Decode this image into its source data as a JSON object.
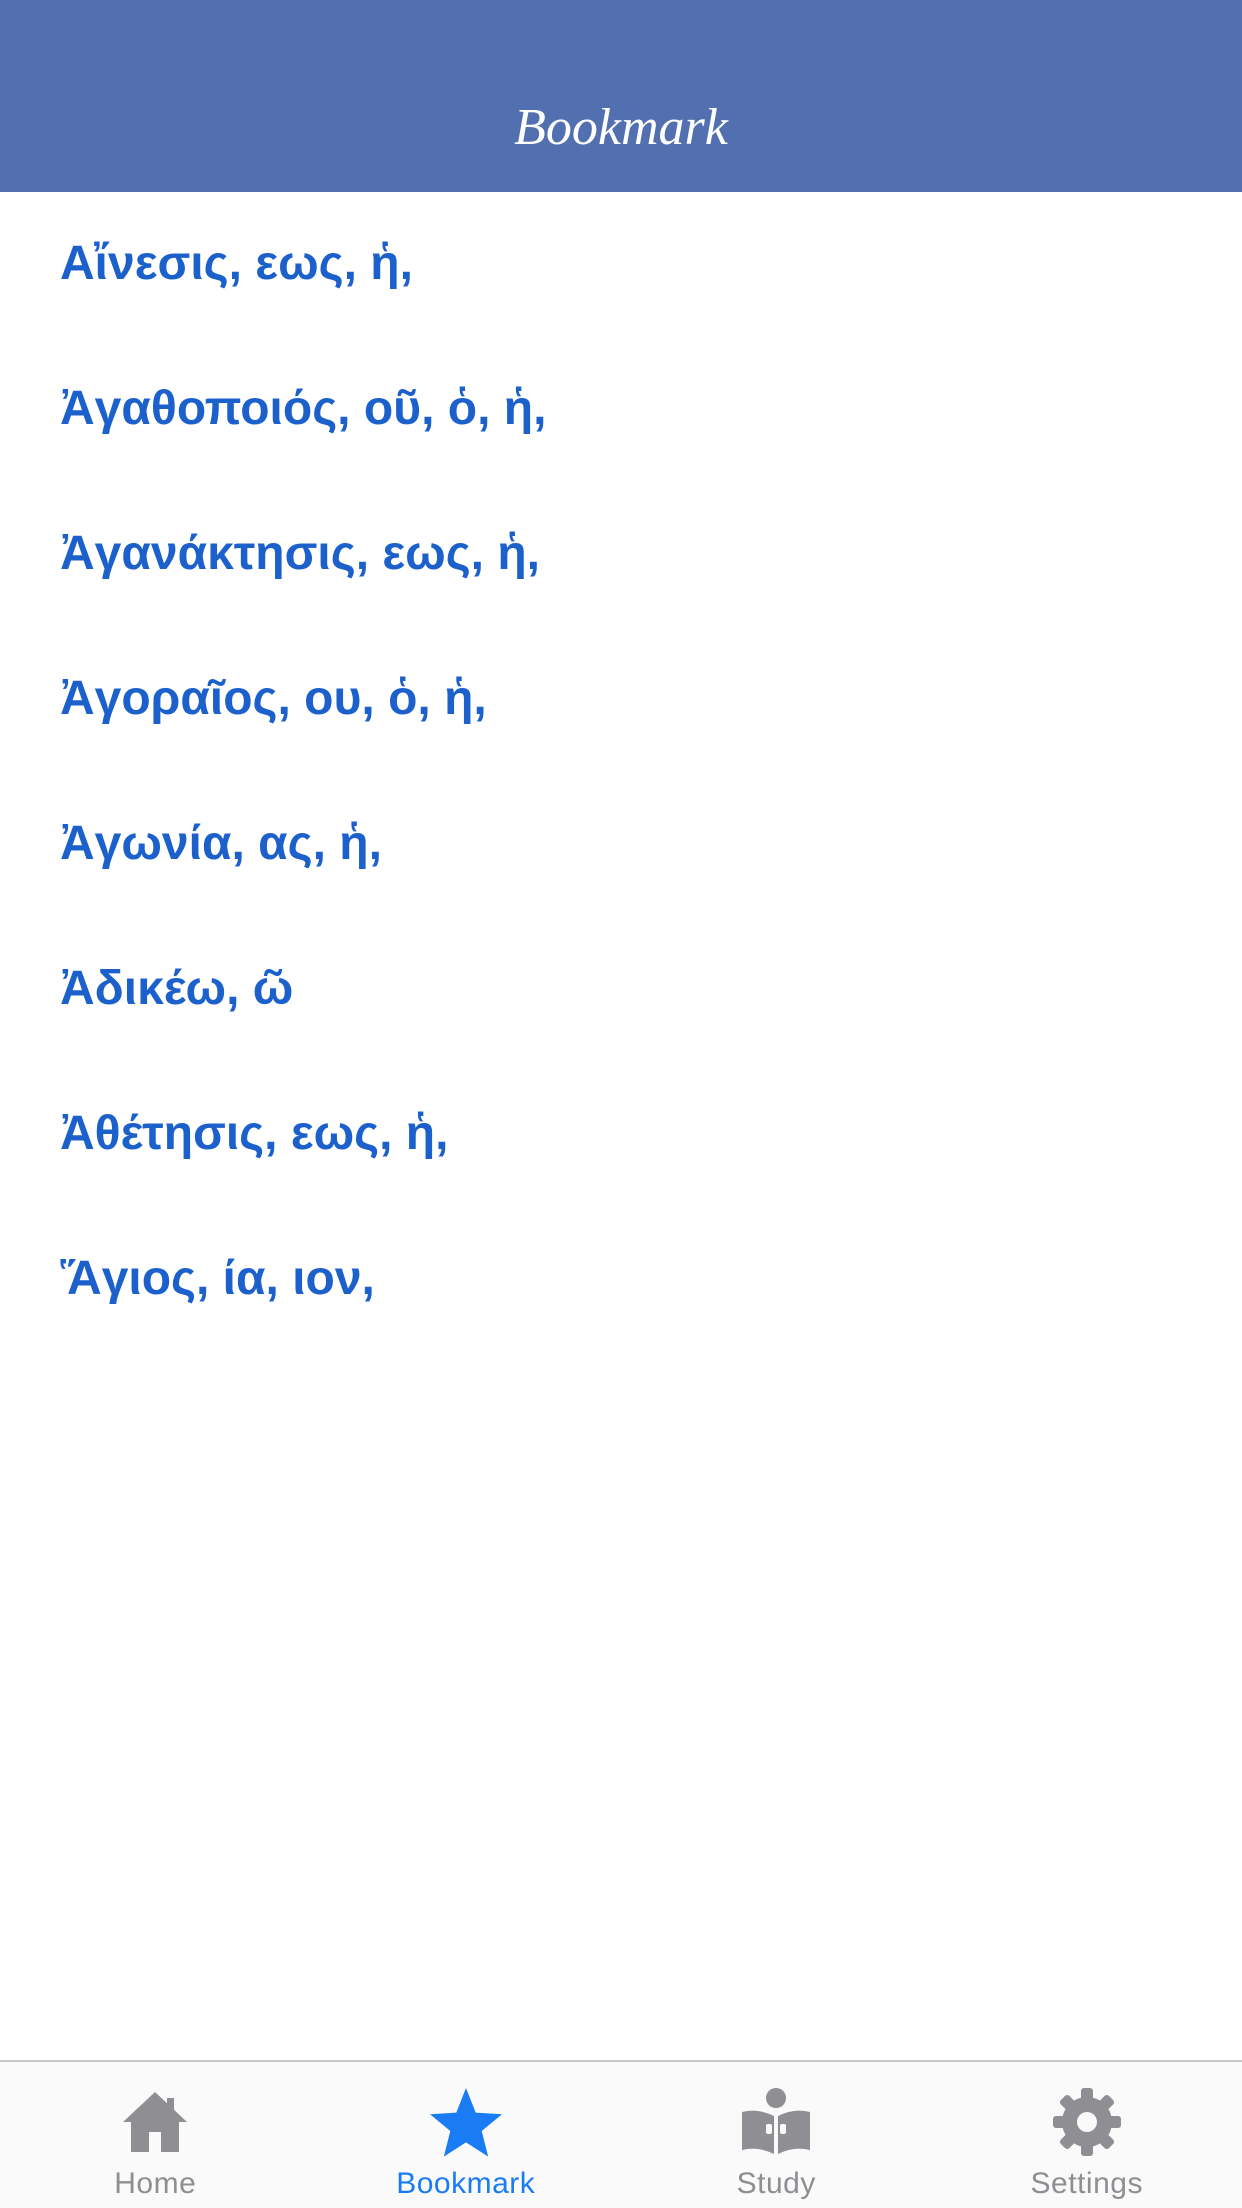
{
  "header": {
    "title": "Bookmark"
  },
  "bookmarks": [
    "Αἴνεσις, εως, ἡ,",
    "Ἀγαθοποιός, οῦ, ὁ, ἡ,",
    "Ἀγανάκτησις, εως, ἡ,",
    "Ἀγοραῖος, ου, ὁ, ἡ,",
    "Ἀγωνία, ας, ἡ,",
    "Ἀδικέω, ῶ",
    "Ἀθέτησις, εως, ἡ,",
    "Ἅγιος, ία, ιον,"
  ],
  "tabs": [
    {
      "label": "Home",
      "icon": "home-icon",
      "active": false
    },
    {
      "label": "Bookmark",
      "icon": "star-icon",
      "active": true
    },
    {
      "label": "Study",
      "icon": "book-icon",
      "active": false
    },
    {
      "label": "Settings",
      "icon": "gear-icon",
      "active": false
    }
  ],
  "colors": {
    "header_bg": "#5270b0",
    "bookmark_text": "#1c60cc",
    "tab_active": "#1a7cf5",
    "tab_inactive": "#8e8e93"
  }
}
